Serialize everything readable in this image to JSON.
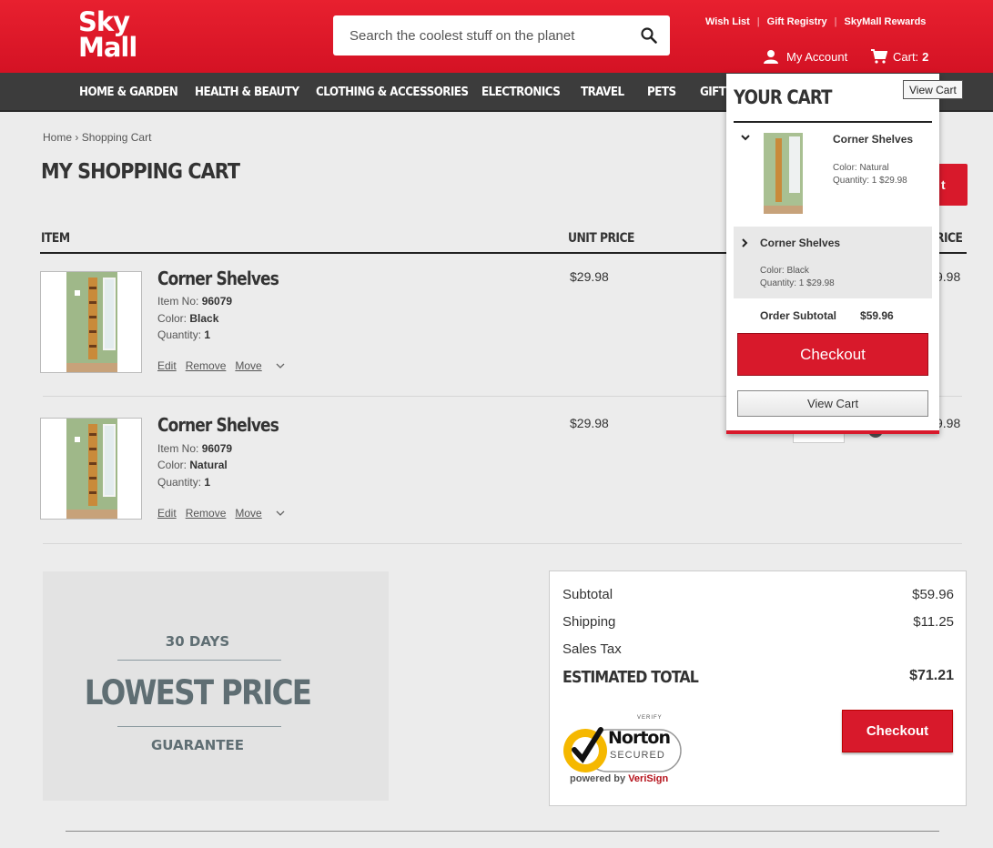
{
  "header": {
    "logo_line1": "Sky",
    "logo_line2": "Mall",
    "search_placeholder": "Search the coolest stuff on the planet",
    "toplinks": [
      "Wish List",
      "Gift Registry",
      "SkyMall Rewards"
    ],
    "account_label": "My Account",
    "cart_label": "Cart:",
    "cart_count": "2"
  },
  "nav": {
    "items": [
      "HOME & GARDEN",
      "HEALTH & BEAUTY",
      "CLOTHING & ACCESSORIES",
      "ELECTRONICS",
      "TRAVEL",
      "PETS",
      "GIFT"
    ]
  },
  "breadcrumb": {
    "home": "Home",
    "sep": "›",
    "current": "Shopping Cart"
  },
  "page_title": "MY SHOPPING CART",
  "partial_button_text": "t",
  "columns": {
    "item": "ITEM",
    "unit_price": "UNIT PRICE",
    "total_partial": "RICE"
  },
  "cart_items": [
    {
      "name": "Corner Shelves",
      "item_no_label": "Item No:",
      "item_no": "96079",
      "color_label": "Color:",
      "color": "Black",
      "quantity_label": "Quantity:",
      "quantity": "1",
      "actions": [
        "Edit",
        "Remove",
        "Move"
      ],
      "unit_price": "$29.98",
      "total_partial": "9.98"
    },
    {
      "name": "Corner Shelves",
      "item_no_label": "Item No:",
      "item_no": "96079",
      "color_label": "Color:",
      "color": "Natural",
      "quantity_label": "Quantity:",
      "quantity": "1",
      "actions": [
        "Edit",
        "Remove",
        "Move"
      ],
      "unit_price": "$29.98",
      "total_partial": "9.98"
    }
  ],
  "guarantee": {
    "days": "30 DAYS",
    "headline": "LOWEST PRICE",
    "footer": "GUARANTEE"
  },
  "summary": {
    "subtotal_label": "Subtotal",
    "subtotal": "$59.96",
    "shipping_label": "Shipping",
    "shipping": "$11.25",
    "tax_label": "Sales Tax",
    "estimated_label": "ESTIMATED TOTAL",
    "estimated": "$71.21",
    "checkout_label": "Checkout",
    "norton_verify": "VERIFY",
    "norton_brand": "Norton",
    "norton_secured": "SECURED",
    "norton_powered": "powered by",
    "norton_verisign": "VeriSign"
  },
  "mini_cart": {
    "title": "YOUR CART",
    "items": [
      {
        "name": "Corner Shelves",
        "color_line": "Color: Natural",
        "qty_line": "Quantity: 1 $29.98"
      },
      {
        "name": "Corner Shelves",
        "color_line": "Color: Black",
        "qty_line": "Quantity: 1 $29.98"
      }
    ],
    "subtotal_label": "Order Subtotal",
    "subtotal": "$59.96",
    "checkout_label": "Checkout",
    "viewcart_label": "View Cart"
  },
  "tooltip": "View Cart",
  "colors": {
    "brand_red": "#d8192b",
    "nav_dark": "#3c3c3c",
    "guarantee_text": "#5f6e73"
  }
}
